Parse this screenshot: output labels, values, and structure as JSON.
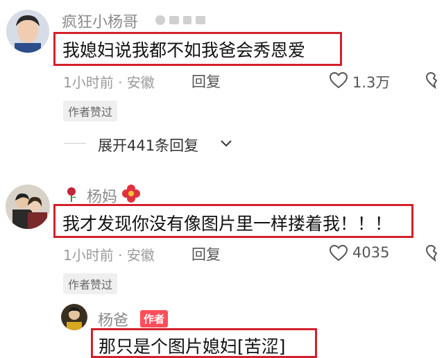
{
  "comments": [
    {
      "username": "疯狂小杨哥",
      "text": "我媳妇说我都不如我爸会秀恩爱",
      "time_location": "1小时前 · 安徽",
      "reply_label": "回复",
      "likes": "1.3万",
      "author_liked": "作者赞过",
      "expand_label": "展开441条回复"
    },
    {
      "username": "杨妈",
      "text": "我才发现你没有像图片里一样搂着我！！！",
      "time_location": "1小时前 · 安徽",
      "reply_label": "回复",
      "likes": "4035",
      "author_liked": "作者赞过"
    },
    {
      "username": "杨爸",
      "badge": "作者",
      "text": "那只是个图片媳妇[苦涩]"
    }
  ],
  "colors": {
    "highlight_border": "#d4202a",
    "author_badge": "#ff4e5a"
  }
}
